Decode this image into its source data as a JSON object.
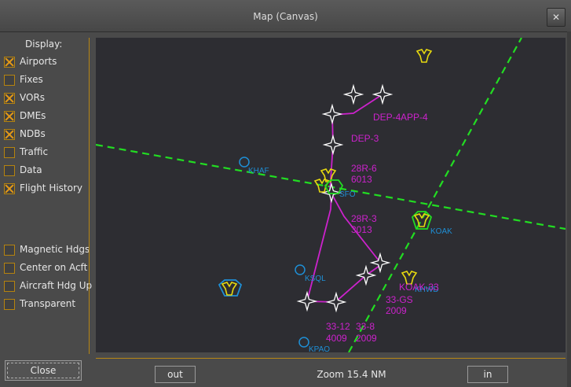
{
  "window": {
    "title": "Map (Canvas)"
  },
  "sidebar": {
    "display_label": "Display:",
    "options": [
      {
        "label": "Airports",
        "checked": true
      },
      {
        "label": "Fixes",
        "checked": false
      },
      {
        "label": "VORs",
        "checked": true
      },
      {
        "label": "DMEs",
        "checked": true
      },
      {
        "label": "NDBs",
        "checked": true
      },
      {
        "label": "Traffic",
        "checked": false
      },
      {
        "label": "Data",
        "checked": false
      },
      {
        "label": "Flight History",
        "checked": true
      }
    ],
    "options2": [
      {
        "label": "Magnetic Hdgs",
        "checked": false
      },
      {
        "label": "Center on Acft",
        "checked": false
      },
      {
        "label": "Aircraft Hdg Up",
        "checked": false
      },
      {
        "label": "Transparent",
        "checked": false
      }
    ],
    "close_label": "Close"
  },
  "map": {
    "airport_labels": [
      "KHAF",
      "KSQL",
      "KPAO",
      "KOAK",
      "KHWD",
      "SFO"
    ],
    "route_labels": [
      "DEP-4",
      "APP-4",
      "DEP-3",
      "28R-6",
      "6013",
      "28R-3",
      "3013",
      "KOAK-33",
      "33-GS",
      "2009",
      "33-12",
      "4009",
      "33-8",
      "2009"
    ]
  },
  "footer": {
    "out_label": "out",
    "zoom_label": "Zoom 15.4 NM",
    "in_label": "in"
  },
  "colors": {
    "route": "#cc22cc",
    "centerline": "#22dd22",
    "airport": "#1e8fd6",
    "vor": "#e5d80f",
    "accent": "#b78614"
  }
}
